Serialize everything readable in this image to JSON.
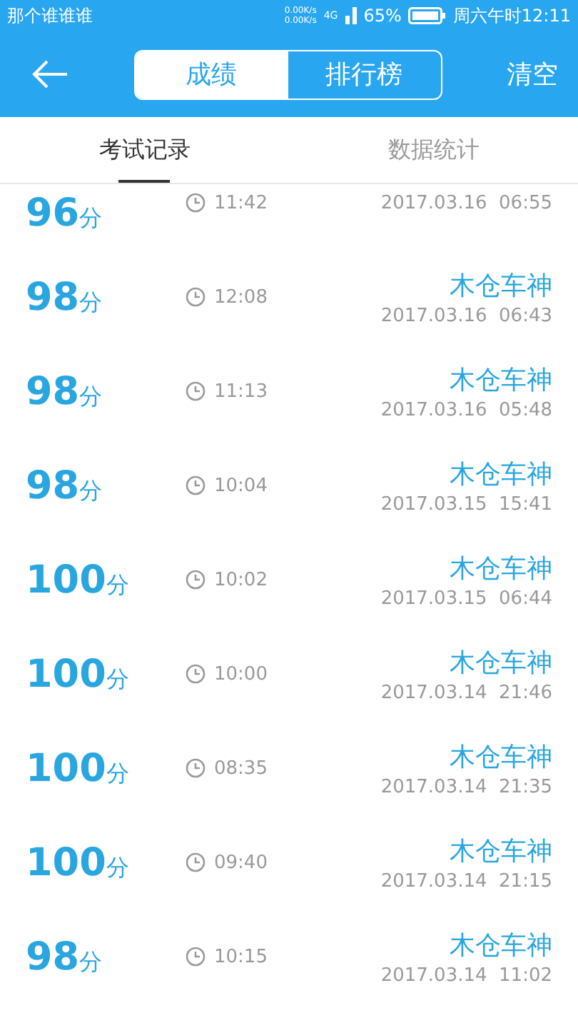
{
  "status_bar": {
    "carrier": "那个谁谁谁",
    "net_speed_up": "0.00K/s",
    "net_speed_down": "0.00K/s",
    "network": "4G",
    "battery": "65%",
    "clock": "周六午时12:11"
  },
  "header": {
    "segments": [
      {
        "label": "成绩",
        "selected": true
      },
      {
        "label": "排行榜",
        "selected": false
      }
    ],
    "action": "清空"
  },
  "tabs": [
    {
      "label": "考试记录",
      "selected": true
    },
    {
      "label": "数据统计",
      "selected": false
    }
  ],
  "records": [
    {
      "score": "96",
      "unit": "分",
      "time": "11:42",
      "date": "2017.03.16  06:55"
    },
    {
      "score": "98",
      "unit": "分",
      "time": "12:08",
      "name": "木仓车神",
      "date": "2017.03.16  06:43"
    },
    {
      "score": "98",
      "unit": "分",
      "time": "11:13",
      "name": "木仓车神",
      "date": "2017.03.16  05:48"
    },
    {
      "score": "98",
      "unit": "分",
      "time": "10:04",
      "name": "木仓车神",
      "date": "2017.03.15  15:41"
    },
    {
      "score": "100",
      "unit": "分",
      "time": "10:02",
      "name": "木仓车神",
      "date": "2017.03.15  06:44"
    },
    {
      "score": "100",
      "unit": "分",
      "time": "10:00",
      "name": "木仓车神",
      "date": "2017.03.14  21:46"
    },
    {
      "score": "100",
      "unit": "分",
      "time": "08:35",
      "name": "木仓车神",
      "date": "2017.03.14  21:35"
    },
    {
      "score": "100",
      "unit": "分",
      "time": "09:40",
      "name": "木仓车神",
      "date": "2017.03.14  21:15"
    },
    {
      "score": "98",
      "unit": "分",
      "time": "10:15",
      "name": "木仓车神",
      "date": "2017.03.14  11:02"
    }
  ]
}
